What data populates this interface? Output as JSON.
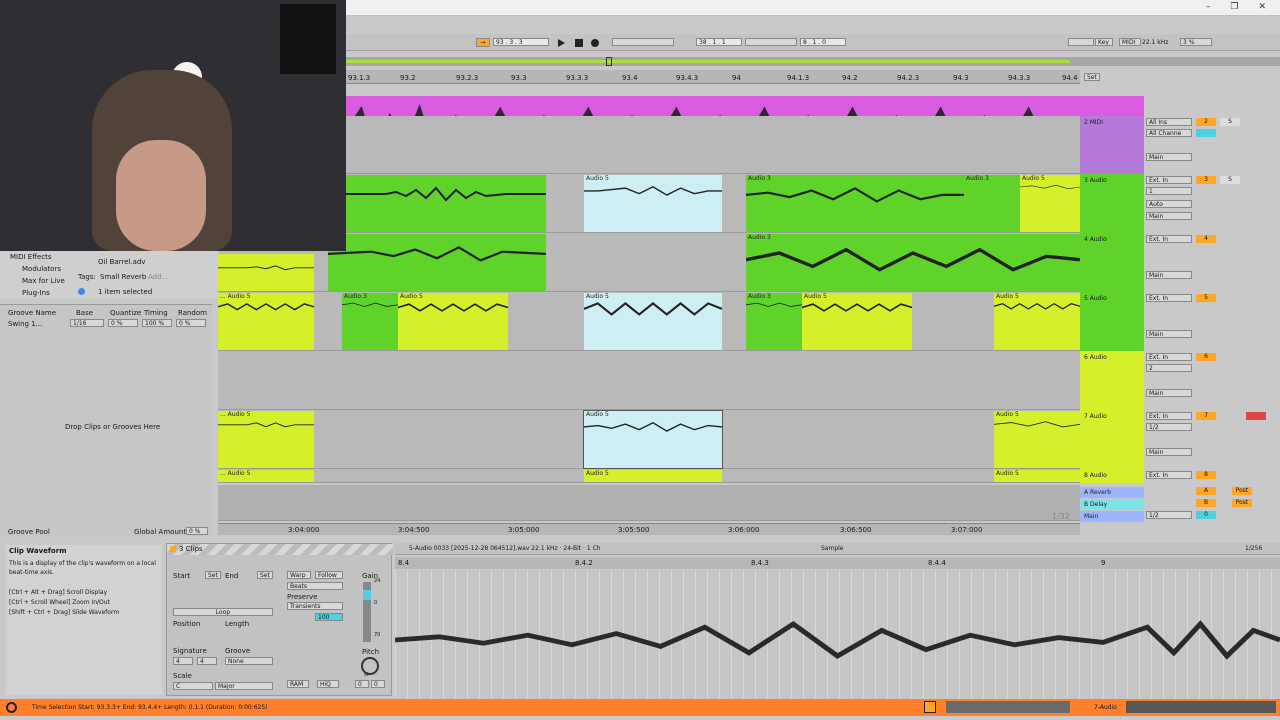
{
  "window": {
    "controls": [
      "–",
      "❐",
      "✕"
    ]
  },
  "transport": {
    "follow_icon": "→",
    "position": "93 .   3 .   3",
    "loop_start": "38 .   1 .   1",
    "loop_length": "8 .   1 .   0",
    "key_label": "Key",
    "midi_label": "MIDI",
    "sample_rate": "22.1 kHz",
    "cpu": "3 %"
  },
  "timeline": {
    "bars": [
      "93.1.3",
      "93.2",
      "93.2.3",
      "93.3",
      "93.3.3",
      "93.4",
      "93.4.3",
      "94",
      "94.1.3",
      "94.2",
      "94.2.3",
      "94.3",
      "94.3.3",
      "94.4"
    ],
    "set_label": "Set",
    "times": [
      "3:04:000",
      "3:04:500",
      "3:05:000",
      "3:05:500",
      "3:06:000",
      "3:06:500",
      "3:07:000"
    ],
    "zoom": "1/32"
  },
  "browser": {
    "categories": [
      "MIDI Effects",
      "Modulators",
      "Max for Live",
      "Plug-Ins"
    ],
    "file": "Oil Barrel.adv",
    "tags_label": "Tags:",
    "tag": "Small Reverb",
    "add_label": "Add...",
    "selection": "1 item selected"
  },
  "groove": {
    "headers": [
      "Groove Name",
      "Base",
      "Quantize",
      "Timing",
      "Random"
    ],
    "row": {
      "name": "Swing 1...",
      "base": "1/16",
      "quantize": "0 %",
      "timing": "100 %",
      "random": "0 %"
    },
    "drop_hint": "Drop Clips or Grooves Here",
    "pool_label": "Groove Pool",
    "global_amount_label": "Global Amount",
    "global_amount": "0 %"
  },
  "tracks": [
    {
      "name": "2 MIDI",
      "color": "#b57ad9",
      "input": "All Ins",
      "channel": "All Channe",
      "num": "2"
    },
    {
      "name": "3 Audio",
      "color": "#5fd32a",
      "input": "Ext. In",
      "channel": "1",
      "num": "3"
    },
    {
      "name": "4 Audio",
      "color": "#5fd32a",
      "input": "Ext. In",
      "channel": "1",
      "num": "4"
    },
    {
      "name": "5 Audio",
      "color": "#5fd32a",
      "input": "Ext. In",
      "channel": "1",
      "num": "5"
    },
    {
      "name": "6 Audio",
      "color": "#d5f02b",
      "input": "Ext. In",
      "channel": "2",
      "num": "6"
    },
    {
      "name": "7 Audio",
      "color": "#d5f02b",
      "input": "Ext. In",
      "channel": "1/2",
      "num": "7"
    },
    {
      "name": "8 Audio",
      "color": "#d5f02b",
      "input": "Ext. In",
      "channel": "",
      "num": "8"
    }
  ],
  "returns": [
    {
      "name": "A Reverb",
      "color": "#9db5ff",
      "num": "A"
    },
    {
      "name": "B Delay",
      "color": "#7de3e6",
      "num": "B"
    },
    {
      "name": "Main",
      "color": "#9db5ff",
      "num": "0",
      "channel": "1/2"
    }
  ],
  "mixer_labels": {
    "in": "In",
    "auto": "Auto",
    "off": "Off",
    "main": "Main",
    "s": "S",
    "c": "C",
    "inf": "-∞",
    "post": "Post"
  },
  "clip_labels": {
    "audio5": "Audio 5",
    "audio3": "Audio 3",
    "audio5_trunc": "... Audio 5"
  },
  "info": {
    "title": "Clip Waveform",
    "text": "This is a display of the clip's waveform on a local beat-time axis.",
    "shortcuts": [
      "[Ctrl + Alt + Drag] Scroll Display",
      "[Ctrl + Scroll Wheel] Zoom In/Out",
      "[Shift + Ctrl + Drag] Slide Waveform"
    ]
  },
  "clip_view": {
    "header": "3 Clips",
    "start_label": "Start",
    "end_label": "End",
    "set_label": "Set",
    "loop_label": "Loop",
    "position_label": "Position",
    "length_label": "Length",
    "signature_label": "Signature",
    "groove_label": "Groove",
    "sig_num": "4",
    "sig_den": "4",
    "groove_value": "None",
    "scale_label": "Scale",
    "scale_root": "C",
    "scale_mode": "Major",
    "warp_label": "Warp",
    "follow_label": "Follow",
    "beats_label": "Beats",
    "preserve_label": "Preserve",
    "preserve_value": "Transients",
    "env_value": "100",
    "gain_label": "Gain",
    "gain_top": "24",
    "gain_mid": "0",
    "gain_low": "70",
    "pitch_label": "Pitch",
    "pitch_st": "st",
    "pitch_value": "0",
    "pitch_cents": "0",
    "ram_label": "RAM",
    "hiq_label": "HiQ",
    "file_info": "5-Audio 0033 [2025-12-28 064512].wav  22.1 kHz · 24-Bit · 1 Ch",
    "sample_label": "Sample",
    "zoom": "1/256",
    "ruler": [
      "8.4",
      "8.4.2",
      "8.4.3",
      "8.4.4",
      "9"
    ]
  },
  "status": {
    "text": "Time Selection   Start: 93.3.3+   End: 93.4.4+   Length: 0.1.1   (Duration: 0:00:625)",
    "track": "7-Audio"
  },
  "colors": {
    "green": "#5fd32a",
    "yellow": "#d5f02b",
    "cyan": "#cdeef2",
    "magenta": "#d85be0",
    "orange": "#ffa624",
    "status": "#ff7f2a"
  }
}
